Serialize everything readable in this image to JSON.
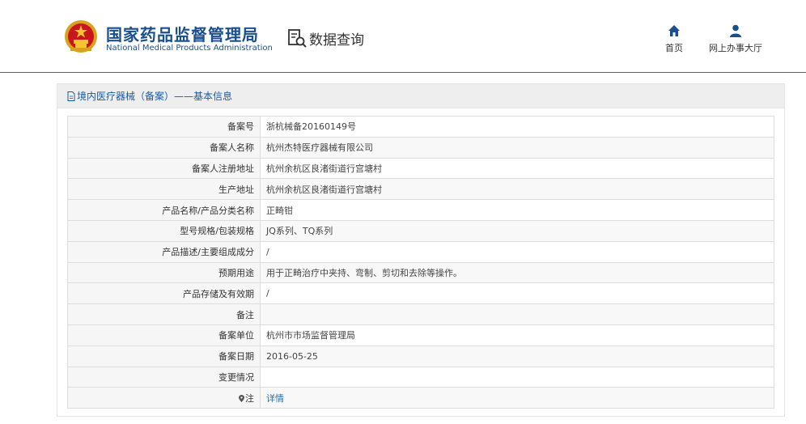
{
  "header": {
    "brand_cn": "国家药品监督管理局",
    "brand_en": "National Medical Products Administration",
    "data_query": "数据查询",
    "nav": {
      "home": "首页",
      "online_hall": "网上办事大厅"
    }
  },
  "panel": {
    "title": "境内医疗器械（备案）——基本信息",
    "rows": [
      {
        "label": "备案号",
        "value": "浙杭械备20160149号"
      },
      {
        "label": "备案人名称",
        "value": "杭州杰特医疗器械有限公司"
      },
      {
        "label": "备案人注册地址",
        "value": "杭州余杭区良渚街道行宫塘村"
      },
      {
        "label": "生产地址",
        "value": "杭州余杭区良渚街道行宫塘村"
      },
      {
        "label": "产品名称/产品分类名称",
        "value": "正畸钳"
      },
      {
        "label": "型号规格/包装规格",
        "value": "JQ系列、TQ系列"
      },
      {
        "label": "产品描述/主要组成成分",
        "value": "/"
      },
      {
        "label": "预期用途",
        "value": "用于正畸治疗中夹持、弯制、剪切和去除等操作。"
      },
      {
        "label": "产品存储及有效期",
        "value": "/"
      },
      {
        "label": "备注",
        "value": ""
      },
      {
        "label": "备案单位",
        "value": "杭州市市场监督管理局"
      },
      {
        "label": "备案日期",
        "value": "2016-05-25"
      },
      {
        "label": "变更情况",
        "value": ""
      },
      {
        "label": "注",
        "value": "详情"
      }
    ]
  },
  "colors": {
    "brand_blue": "#1a4f8f",
    "link_blue": "#1a6fbf",
    "header_rule": "#2f6ea8"
  },
  "icons": [
    "emblem",
    "data-query-icon",
    "home-icon",
    "user-icon",
    "document-icon",
    "location-pin-icon"
  ]
}
